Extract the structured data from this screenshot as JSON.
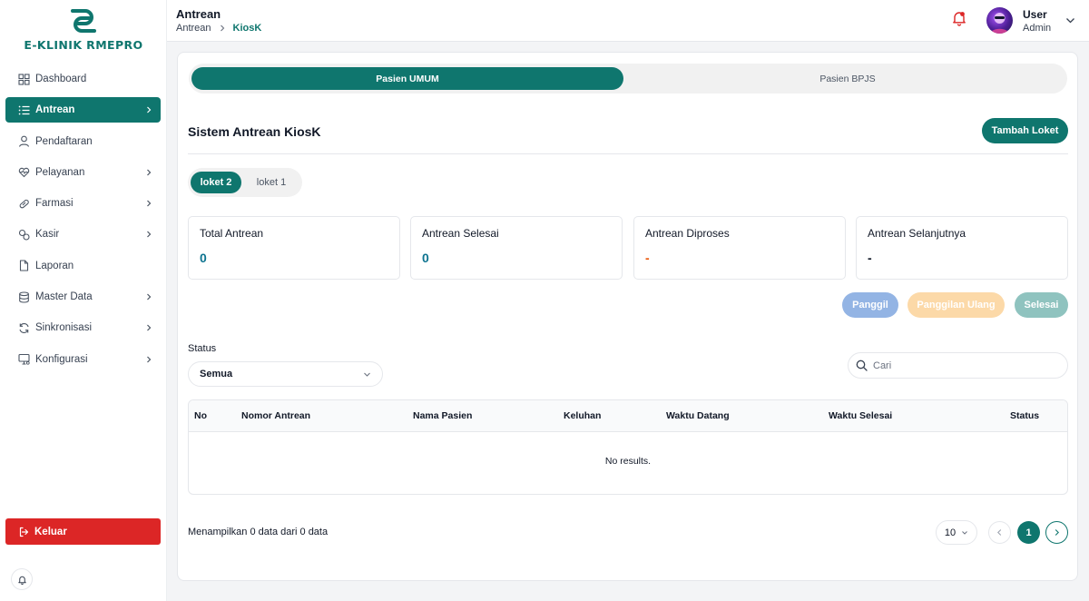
{
  "brand": {
    "name": "E-KLINIK RMEPRO"
  },
  "sidebar": {
    "items": [
      {
        "label": "Dashboard",
        "icon": "grid-icon",
        "has_submenu": false,
        "active": false
      },
      {
        "label": "Antrean",
        "icon": "list-icon",
        "has_submenu": true,
        "active": true
      },
      {
        "label": "Pendaftaran",
        "icon": "user-icon",
        "has_submenu": false,
        "active": false
      },
      {
        "label": "Pelayanan",
        "icon": "heart-pulse-icon",
        "has_submenu": true,
        "active": false
      },
      {
        "label": "Farmasi",
        "icon": "pill-icon",
        "has_submenu": true,
        "active": false
      },
      {
        "label": "Kasir",
        "icon": "cash-icon",
        "has_submenu": true,
        "active": false
      },
      {
        "label": "Laporan",
        "icon": "file-icon",
        "has_submenu": false,
        "active": false
      },
      {
        "label": "Master Data",
        "icon": "database-icon",
        "has_submenu": true,
        "active": false
      },
      {
        "label": "Sinkronisasi",
        "icon": "refresh-icon",
        "has_submenu": true,
        "active": false
      },
      {
        "label": "Konfigurasi",
        "icon": "monitor-settings-icon",
        "has_submenu": true,
        "active": false
      }
    ],
    "logout_label": "Keluar"
  },
  "header": {
    "title": "Antrean",
    "breadcrumb": [
      "Antrean",
      "KiosK"
    ],
    "user": {
      "name": "User",
      "role": "Admin"
    }
  },
  "tabs": [
    {
      "label": "Pasien UMUM",
      "active": true
    },
    {
      "label": "Pasien BPJS",
      "active": false
    }
  ],
  "section": {
    "title": "Sistem Antrean KiosK",
    "add_button": "Tambah Loket"
  },
  "lokets": [
    {
      "label": "loket 2",
      "active": true
    },
    {
      "label": "loket 1",
      "active": false
    }
  ],
  "stats": [
    {
      "label": "Total Antrean",
      "value": "0",
      "color": "#0e7490"
    },
    {
      "label": "Antrean Selesai",
      "value": "0",
      "color": "#0e7490"
    },
    {
      "label": "Antrean Diproses",
      "value": "-",
      "color": "#ea580c"
    },
    {
      "label": "Antrean Selanjutnya",
      "value": "-",
      "color": "#111827"
    }
  ],
  "actions": {
    "call": {
      "label": "Panggil",
      "color": "#93b4e4"
    },
    "recall": {
      "label": "Panggilan Ulang",
      "color": "#fcd9a8"
    },
    "done": {
      "label": "Selesai",
      "color": "#8fc3bf"
    }
  },
  "filter": {
    "status_label": "Status",
    "status_value": "Semua",
    "search_placeholder": "Cari"
  },
  "table": {
    "columns": [
      "No",
      "Nomor Antrean",
      "Nama Pasien",
      "Keluhan",
      "Waktu Datang",
      "Waktu Selesai",
      "Status"
    ],
    "empty_text": "No results."
  },
  "pagination": {
    "info": "Menampilkan 0 data dari 0 data",
    "page_size": "10",
    "current_page": "1"
  },
  "colors": {
    "primary": "#0f766e",
    "danger": "#dc2626"
  }
}
